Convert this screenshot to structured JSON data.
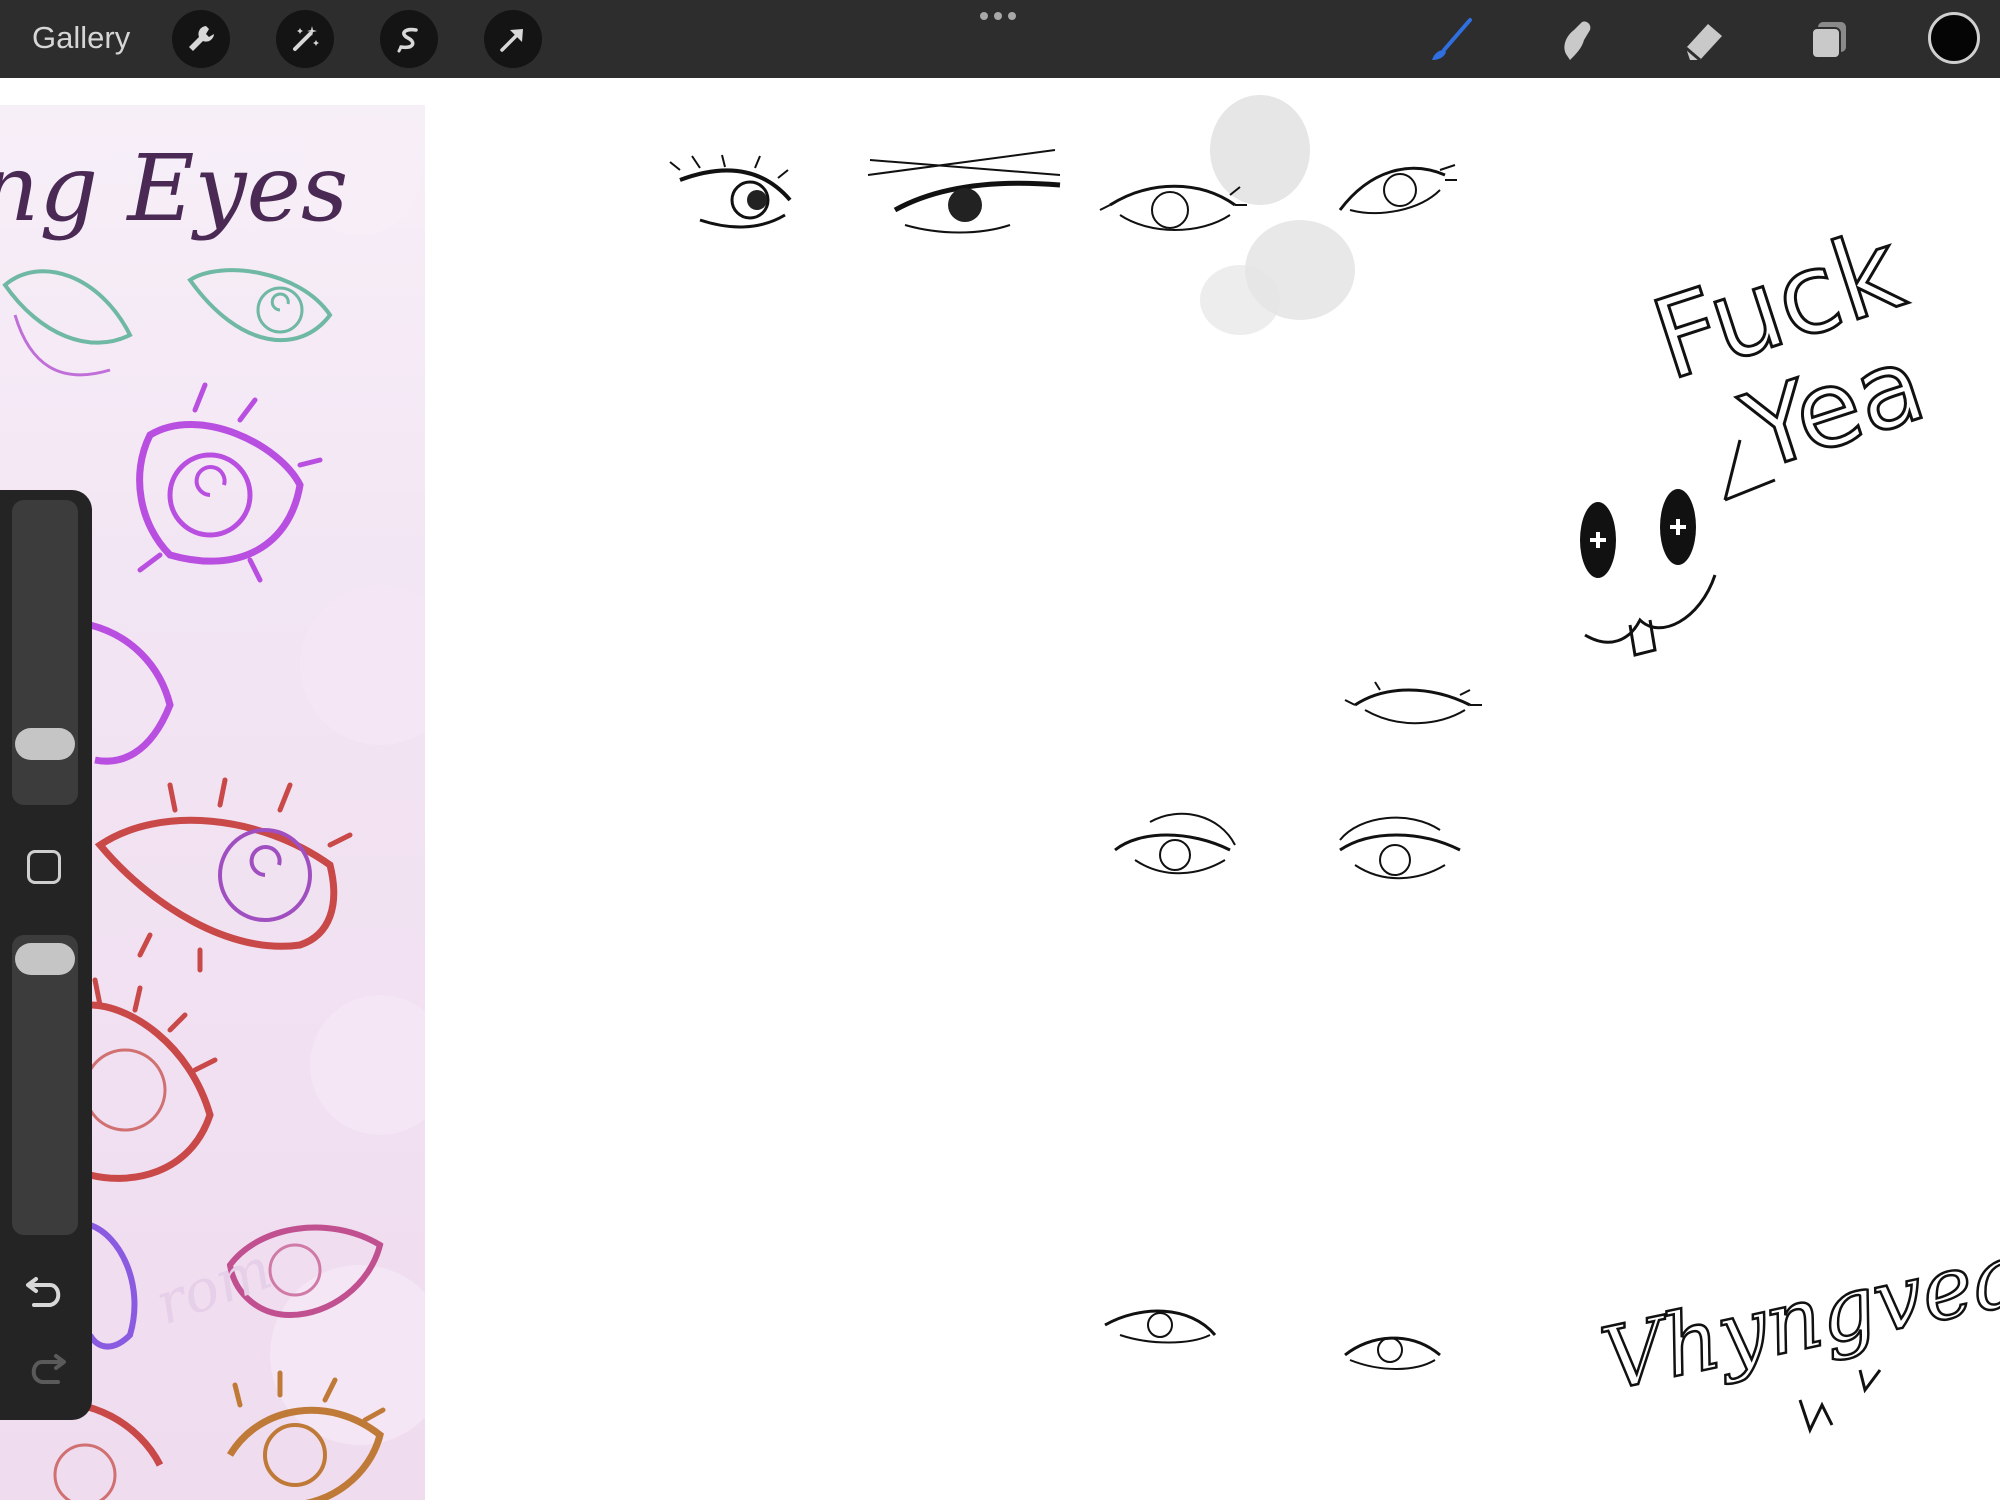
{
  "toolbar": {
    "gallery_label": "Gallery",
    "left_tools": [
      {
        "name": "actions",
        "icon": "wrench-icon"
      },
      {
        "name": "adjustments",
        "icon": "magic-wand-icon"
      },
      {
        "name": "selection",
        "icon": "selection-s-icon"
      },
      {
        "name": "transform",
        "icon": "arrow-cursor-icon"
      }
    ],
    "more_icon": "more-dots-icon",
    "right_tools": [
      {
        "name": "brush",
        "icon": "brush-icon",
        "active": true,
        "color": "#2f6fe0"
      },
      {
        "name": "smudge",
        "icon": "smudge-icon"
      },
      {
        "name": "eraser",
        "icon": "eraser-icon"
      },
      {
        "name": "layers",
        "icon": "layers-icon"
      }
    ],
    "current_color": "#050505"
  },
  "reference": {
    "heading": "ng Eyes",
    "watermark": "rom"
  },
  "canvas": {
    "handwriting_1": "Fuck",
    "handwriting_2": "Yea",
    "signature": "Vhyngveal"
  },
  "sidebar": {
    "brush_size_icon": "brush-size-slider",
    "modify_icon": "eyedropper-square-icon",
    "opacity_icon": "opacity-slider",
    "undo_icon": "undo-icon",
    "redo_icon": "redo-icon"
  }
}
